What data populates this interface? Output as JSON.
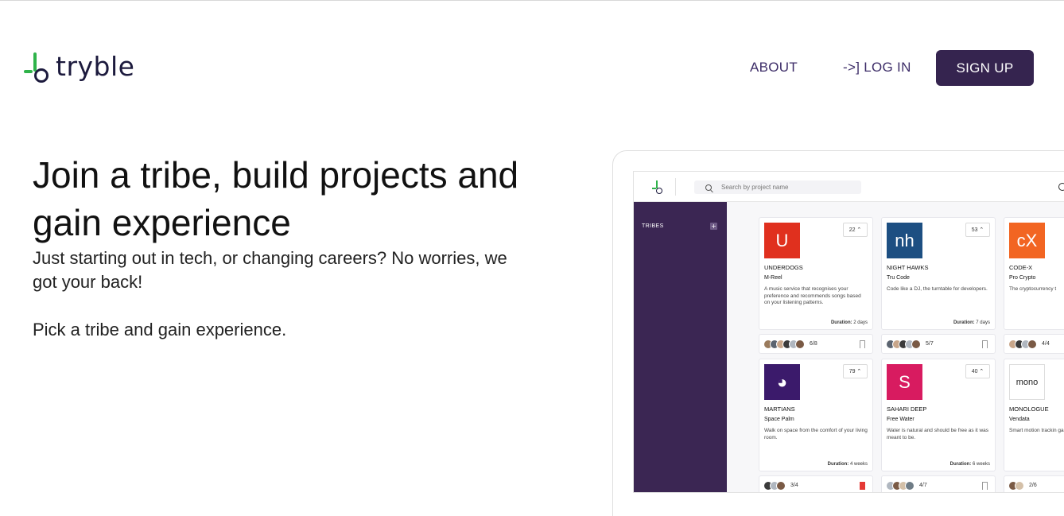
{
  "brand": {
    "name": "tryble"
  },
  "nav": {
    "about": "ABOUT",
    "login": "->] LOG IN",
    "signup": "SIGN UP"
  },
  "hero": {
    "title": "Join a tribe, build projects and gain experience",
    "subtitle": "Just starting out in tech, or changing careers? No worries, we got your back!",
    "subtitle2": "Pick a tribe and gain experience."
  },
  "mockup": {
    "search_placeholder": "Search by project name",
    "sidebar_heading": "TRIBES",
    "sidebar_add": "+",
    "duration_label": "Duration:",
    "cards": [
      {
        "tribe": "UNDERDOGS",
        "project": "M-Reel",
        "desc": "A music service that recognises your preference and recommends songs based on your listening patterns.",
        "votes": "22 ⌃",
        "duration": "2 days",
        "members": "6/8",
        "logo_text": "U",
        "logo_color": "#e0301e",
        "bookmarked": false
      },
      {
        "tribe": "NIGHT HAWKS",
        "project": "Tru Code",
        "desc": "Code like a DJ, the turntable for developers.",
        "votes": "53 ⌃",
        "duration": "7 days",
        "members": "5/7",
        "logo_text": "nh",
        "logo_color": "#1d4f82",
        "bookmarked": false
      },
      {
        "tribe": "CODE-X",
        "project": "Pro Crypto",
        "desc": "The cryptocurrency t",
        "votes": "",
        "duration": "",
        "members": "4/4",
        "logo_text": "cX",
        "logo_color": "#f26522",
        "bookmarked": false
      },
      {
        "tribe": "MARTIANS",
        "project": "Space Palm",
        "desc": "Walk on space from the comfort of your living room.",
        "votes": "79 ⌃",
        "duration": "4 weeks",
        "members": "3/4",
        "logo_text": "◕",
        "logo_color": "#3b1a6b",
        "bookmarked": true
      },
      {
        "tribe": "SAHARI DEEP",
        "project": "Free Water",
        "desc": "Water is natural and should be free as it was meant to be.",
        "votes": "40 ⌃",
        "duration": "6 weeks",
        "members": "4/7",
        "logo_text": "S",
        "logo_color": "#d81b60",
        "bookmarked": false
      },
      {
        "tribe": "MONOLOGUE",
        "project": "Vendata",
        "desc": "Smart motion trackin games.",
        "votes": "",
        "duration": "",
        "members": "2/6",
        "logo_text": "mono",
        "logo_color": "#ffffff",
        "bookmarked": false
      }
    ]
  }
}
